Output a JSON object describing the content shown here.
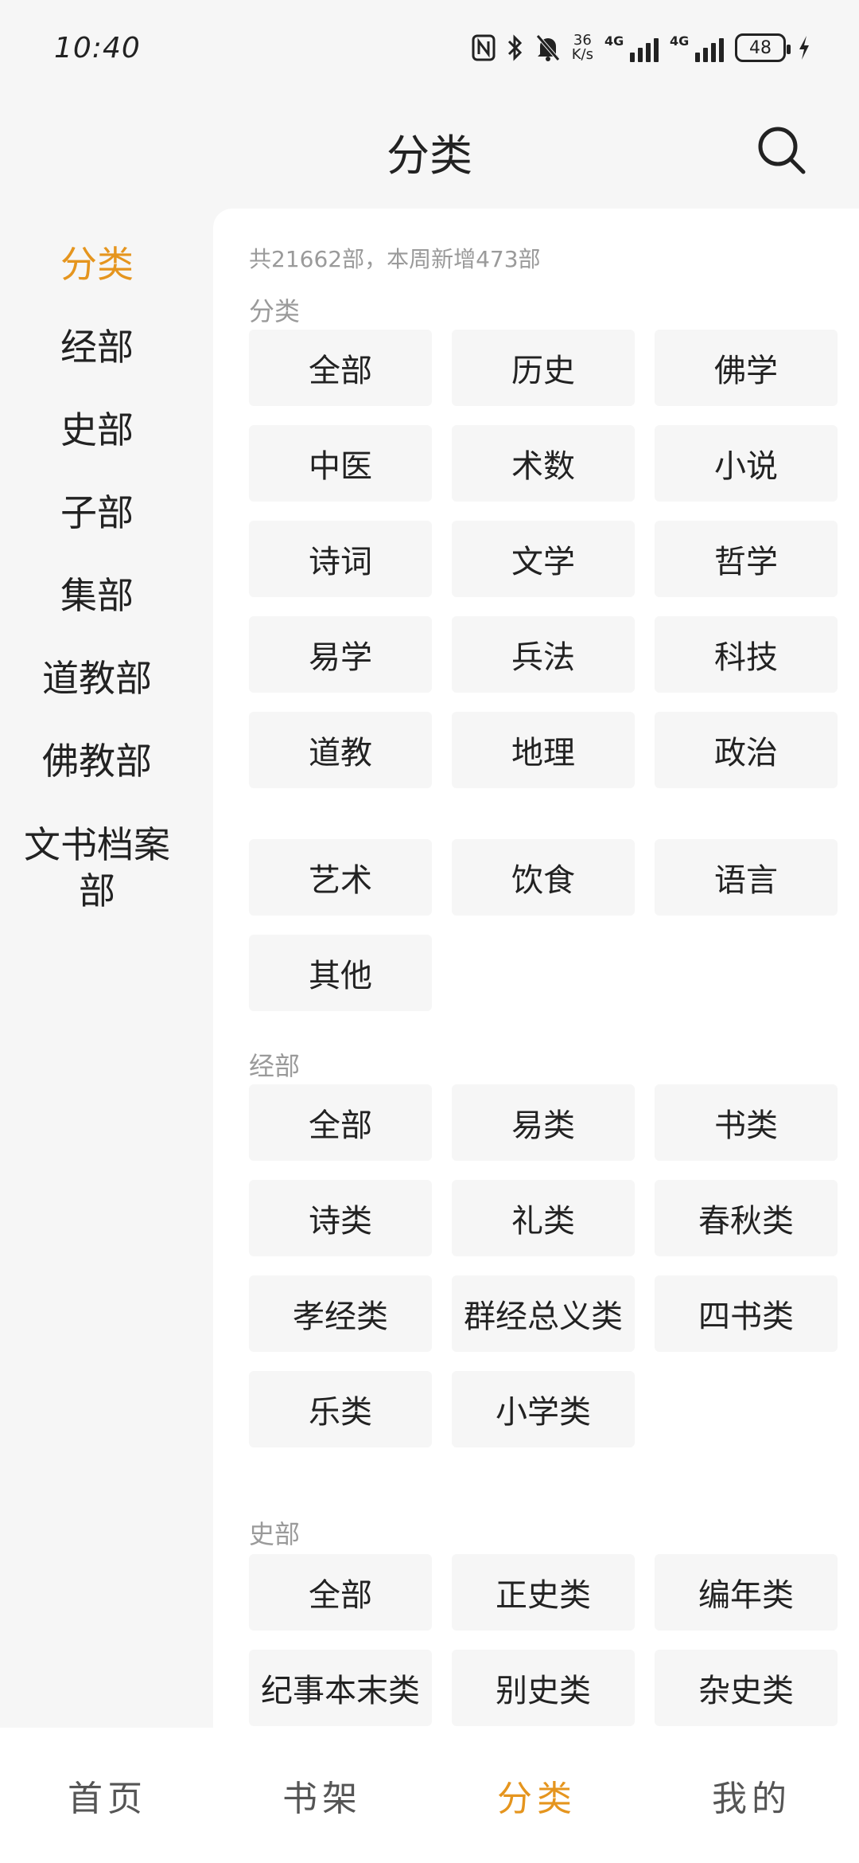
{
  "status_bar": {
    "time": "10:40",
    "net_speed_value": "36",
    "net_speed_unit": "K/s",
    "signal_label_1": "4G",
    "signal_label_2": "4G",
    "battery": "48",
    "icons": [
      "nfc-icon",
      "bluetooth-icon",
      "bell-off-icon",
      "signal-icon",
      "signal-icon",
      "battery-icon",
      "charging-icon"
    ]
  },
  "header": {
    "title": "分类",
    "search_icon": "search-icon"
  },
  "sidebar": {
    "items": [
      {
        "label": "分类",
        "active": true
      },
      {
        "label": "经部"
      },
      {
        "label": "史部"
      },
      {
        "label": "子部"
      },
      {
        "label": "集部"
      },
      {
        "label": "道教部"
      },
      {
        "label": "佛教部"
      },
      {
        "label": "文书档案部"
      }
    ]
  },
  "main": {
    "stats": "共21662部，本周新增473部",
    "sections": [
      {
        "title": "分类",
        "items": [
          "全部",
          "历史",
          "佛学",
          "中医",
          "术数",
          "小说",
          "诗词",
          "文学",
          "哲学",
          "易学",
          "兵法",
          "科技",
          "道教",
          "地理",
          "政治",
          "艺术",
          "饮食",
          "语言",
          "其他"
        ]
      },
      {
        "title": "经部",
        "items": [
          "全部",
          "易类",
          "书类",
          "诗类",
          "礼类",
          "春秋类",
          "孝经类",
          "群经总义类",
          "四书类",
          "乐类",
          "小学类"
        ]
      },
      {
        "title": "史部",
        "items": [
          "全部",
          "正史类",
          "编年类",
          "纪事本末类",
          "别史类",
          "杂史类"
        ]
      }
    ]
  },
  "bottom_nav": {
    "items": [
      {
        "label": "首页"
      },
      {
        "label": "书架"
      },
      {
        "label": "分类",
        "active": true
      },
      {
        "label": "我的"
      }
    ]
  },
  "colors": {
    "accent": "#e5951e",
    "background": "#f6f6f6",
    "panel": "#ffffff",
    "muted_text": "#9a9a9a",
    "chip_bg": "#f6f6f6"
  }
}
